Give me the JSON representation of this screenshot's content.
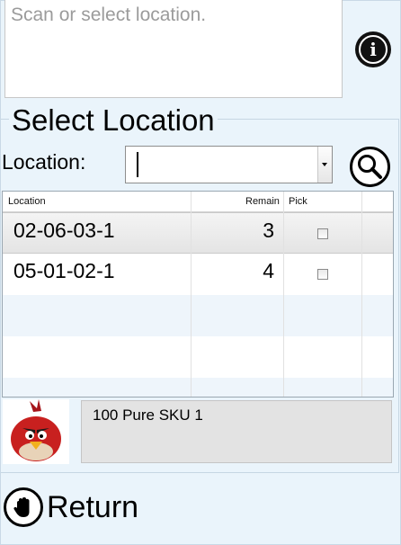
{
  "message": {
    "placeholder": "Scan or select location."
  },
  "section": {
    "title": "Select Location"
  },
  "location": {
    "label": "Location:",
    "value": ""
  },
  "grid": {
    "columns": [
      "Location",
      "Remain",
      "Pick"
    ],
    "rows": [
      {
        "location": "02-06-03-1",
        "remain": "3",
        "pick": false,
        "selected": true
      },
      {
        "location": "05-01-02-1",
        "remain": "4",
        "pick": false,
        "selected": false
      }
    ]
  },
  "product": {
    "name": "100 Pure SKU 1",
    "image": "red-angry-bird"
  },
  "footer": {
    "return_label": "Return"
  },
  "icons": {
    "info": "info-icon",
    "search": "search-icon",
    "return": "stop-hand-icon"
  },
  "colors": {
    "background": "#eaf4fb",
    "bird_red": "#c8201f"
  }
}
